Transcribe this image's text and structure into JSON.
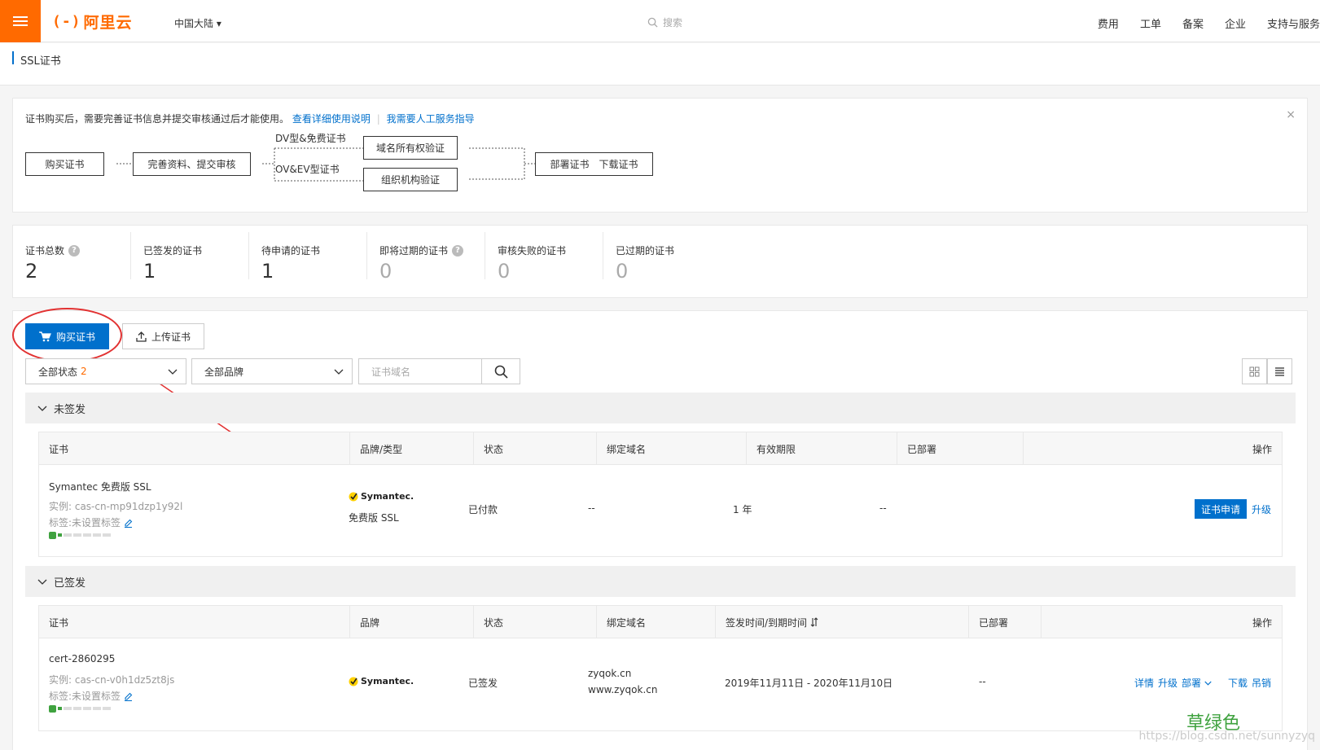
{
  "topbar": {
    "logo_text": "阿里云",
    "region": "中国大陆 ▾",
    "search_placeholder": "搜索",
    "nav": [
      "费用",
      "工单",
      "备案",
      "企业",
      "支持与服务"
    ]
  },
  "breadcrumb": {
    "title": "SSL证书"
  },
  "notice": {
    "text": "证书购买后，需要完善证书信息并提交审核通过后才能使用。",
    "link1": "查看详细使用说明",
    "link2": "我需要人工服务指导",
    "close": "×",
    "flow": {
      "buy": "购买证书",
      "fill": "完善资料、提交审核",
      "dv_label": "DV型&免费证书",
      "ov_label": "OV&EV型证书",
      "domain_verify": "域名所有权验证",
      "org_verify": "组织机构验证",
      "deploy": "部署证书　下载证书"
    }
  },
  "stats": [
    {
      "label": "证书总数",
      "value": "2",
      "help": true
    },
    {
      "label": "已签发的证书",
      "value": "1",
      "help": false
    },
    {
      "label": "待申请的证书",
      "value": "1",
      "help": false
    },
    {
      "label": "即将过期的证书",
      "value": "0",
      "help": true
    },
    {
      "label": "审核失败的证书",
      "value": "0",
      "help": false
    },
    {
      "label": "已过期的证书",
      "value": "0",
      "help": false
    }
  ],
  "toolbar": {
    "buy_label": "购买证书",
    "upload_label": "上传证书",
    "status_filter": "全部状态",
    "status_count": "2",
    "brand_filter": "全部品牌",
    "domain_placeholder": "证书域名"
  },
  "unissued": {
    "group_label": "未签发",
    "headers": [
      "证书",
      "品牌/类型",
      "状态",
      "绑定域名",
      "有效期限",
      "已部署",
      "操作"
    ],
    "row": {
      "name": "Symantec 免费版 SSL",
      "instance": "实例: cas-cn-mp91dzp1y92l",
      "tag": "标签:未设置标签",
      "brand": "Symantec.",
      "type": "免费版 SSL",
      "status": "已付款",
      "domain": "--",
      "period": "1 年",
      "deployed": "--",
      "apply": "证书申请",
      "upgrade": "升级",
      "progress": 0.125
    }
  },
  "issued": {
    "group_label": "已签发",
    "headers": [
      "证书",
      "品牌",
      "状态",
      "绑定域名",
      "签发时间/到期时间",
      "已部署",
      "操作"
    ],
    "row": {
      "name": "cert-2860295",
      "instance": "实例: cas-cn-v0h1dz5zt8js",
      "tag": "标签:未设置标签",
      "brand": "Symantec.",
      "status": "已签发",
      "domain1": "zyqok.cn",
      "domain2": "www.zyqok.cn",
      "period": "2019年11月11日 - 2020年11月10日",
      "deployed": "--",
      "ops": [
        "详情",
        "升级",
        "部署",
        "下载",
        "吊销"
      ],
      "progress": 0.125
    }
  },
  "watermark": {
    "text": "草绿色",
    "url": "https://blog.csdn.net/sunnyzyq"
  },
  "colors": {
    "accent": "#0070cc",
    "brand": "#ff6a00",
    "annotation": "#e23232",
    "success": "#3fa23f"
  }
}
